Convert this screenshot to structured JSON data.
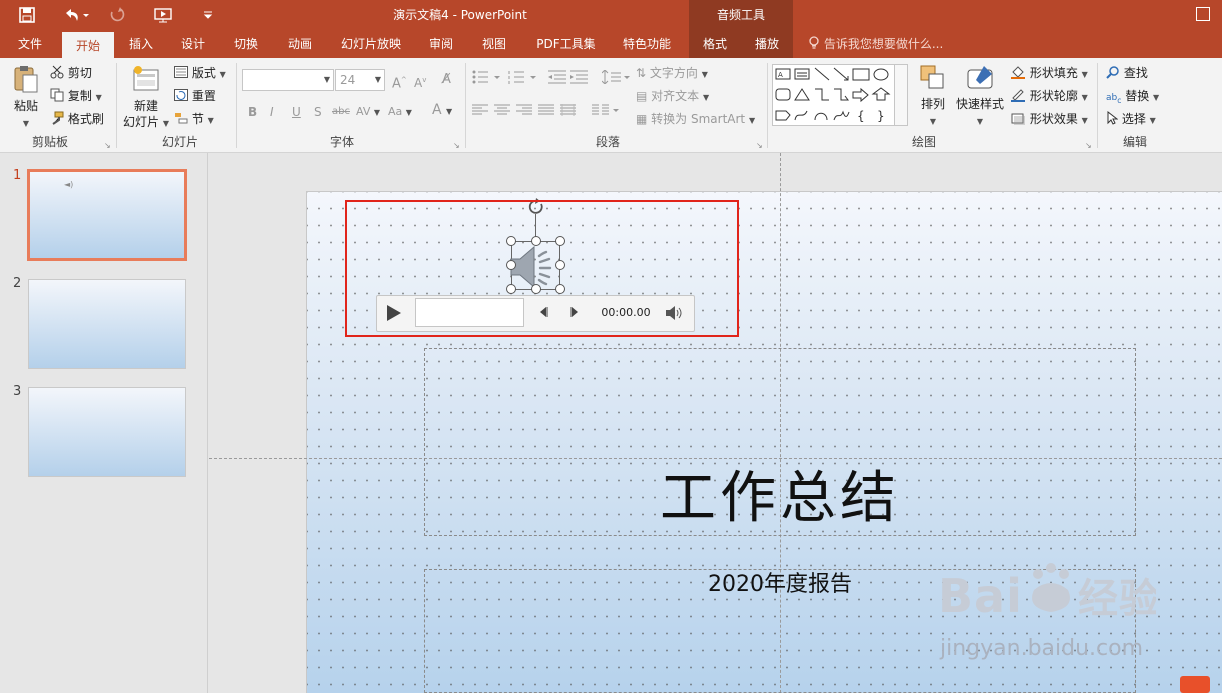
{
  "title_bar": {
    "doc_title": "演示文稿4 - PowerPoint",
    "context_group": "音频工具"
  },
  "tabs": [
    "文件",
    "开始",
    "插入",
    "设计",
    "切换",
    "动画",
    "幻灯片放映",
    "审阅",
    "视图",
    "PDF工具集",
    "特色功能",
    "格式",
    "播放"
  ],
  "active_tab": "开始",
  "tell_me": "告诉我您想要做什么...",
  "ribbon": {
    "clipboard": {
      "paste": "粘贴",
      "cut": "剪切",
      "copy": "复制",
      "format_painter": "格式刷",
      "label": "剪贴板"
    },
    "slides": {
      "new_slide_1": "新建",
      "new_slide_2": "幻灯片",
      "layout": "版式",
      "reset": "重置",
      "section": "节",
      "label": "幻灯片"
    },
    "font": {
      "size": "24",
      "label": "字体"
    },
    "paragraph": {
      "text_direction": "文字方向",
      "align_text": "对齐文本",
      "convert_smartart": "转换为 SmartArt",
      "label": "段落"
    },
    "drawing": {
      "arrange": "排列",
      "quick_styles": "快速样式",
      "shape_fill": "形状填充",
      "shape_outline": "形状轮廓",
      "shape_effects": "形状效果",
      "label": "绘图"
    },
    "editing": {
      "find": "查找",
      "replace": "替换",
      "select": "选择",
      "label": "编辑"
    }
  },
  "thumbnails": [
    {
      "num": "1",
      "selected": true
    },
    {
      "num": "2",
      "selected": false
    },
    {
      "num": "3",
      "selected": false
    }
  ],
  "slide": {
    "title": "工作总结",
    "subtitle": "2020年度报告"
  },
  "audio_player": {
    "time": "00:00.00"
  },
  "watermark": {
    "logo": "Bai du 经验",
    "url": "jingyan.baidu.com"
  },
  "colors": {
    "accent": "#b7472a",
    "context_tab": "#8f3a22",
    "highlight": "#e1251b"
  }
}
